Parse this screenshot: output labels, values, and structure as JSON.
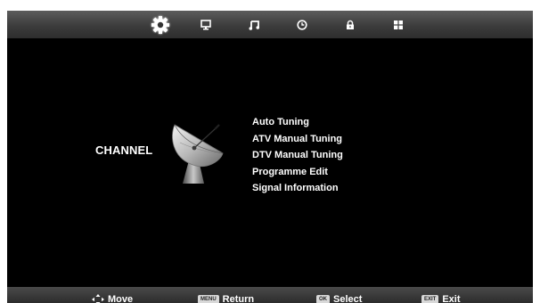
{
  "top_tabs": [
    {
      "icon": "settings-gear-icon",
      "active": true
    },
    {
      "icon": "picture-monitor-icon",
      "active": false
    },
    {
      "icon": "sound-note-icon",
      "active": false
    },
    {
      "icon": "time-clock-icon",
      "active": false
    },
    {
      "icon": "lock-icon",
      "active": false
    },
    {
      "icon": "setup-grid-icon",
      "active": false
    }
  ],
  "section_title": "CHANNEL",
  "section_icon": "satellite-dish-icon",
  "menu": {
    "items": [
      {
        "label": "Auto Tuning"
      },
      {
        "label": "ATV Manual Tuning"
      },
      {
        "label": "DTV Manual Tuning"
      },
      {
        "label": "Programme Edit"
      },
      {
        "label": "Signal Information"
      }
    ]
  },
  "footer": {
    "move": {
      "icon": "dpad-arrows-icon",
      "label": "Move"
    },
    "return": {
      "key": "MENU",
      "label": "Return"
    },
    "select": {
      "key": "OK",
      "label": "Select"
    },
    "exit": {
      "key": "EXIT",
      "label": "Exit"
    }
  },
  "colors": {
    "background": "#000000",
    "text": "#ffffff",
    "bar": "#3c3c3c"
  }
}
